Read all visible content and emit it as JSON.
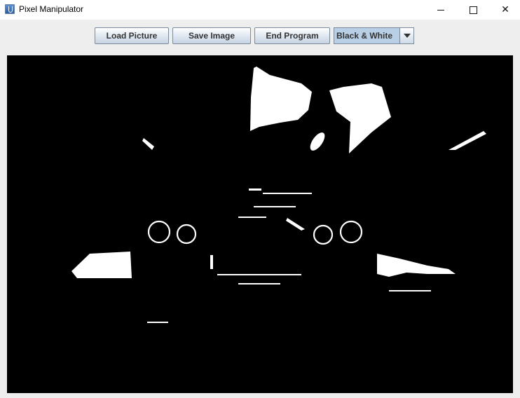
{
  "window": {
    "title": "Pixel Manipulator",
    "icon": "java-cup-icon",
    "controls": [
      "minimize-icon",
      "maximize-icon",
      "close-icon"
    ]
  },
  "toolbar": {
    "load_label": "Load Picture",
    "save_label": "Save Image",
    "end_label": "End Program",
    "filter": {
      "selected": "Black & White",
      "icon": "chevron-down-icon"
    }
  },
  "image": {
    "description_hidden": false,
    "colors": {
      "background": "#000000",
      "foreground": "#ffffff"
    }
  }
}
